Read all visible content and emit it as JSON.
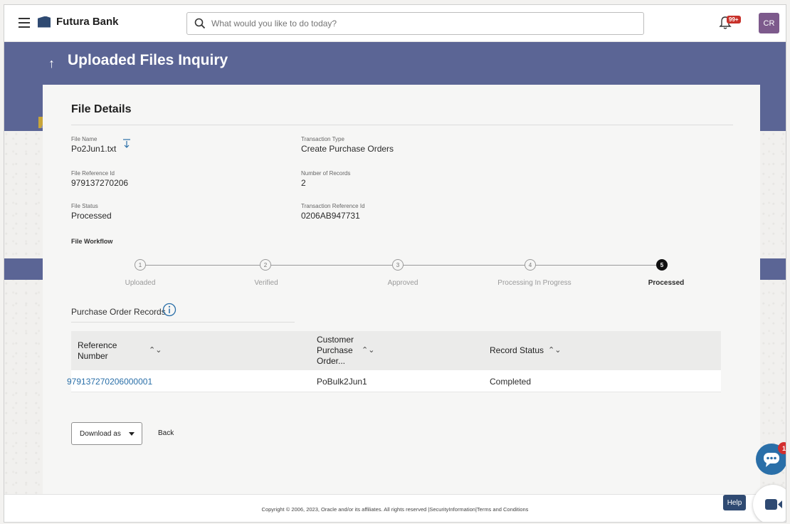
{
  "header": {
    "brand": "Futura Bank",
    "search_placeholder": "What would you like to do today?",
    "notification_badge": "99+",
    "avatar_initials": "CR"
  },
  "page": {
    "title": "Uploaded Files Inquiry"
  },
  "file_details": {
    "section_title": "File Details",
    "fields": {
      "file_name": {
        "label": "File Name",
        "value": "Po2Jun1.txt"
      },
      "transaction_type": {
        "label": "Transaction Type",
        "value": "Create Purchase Orders"
      },
      "file_reference_id": {
        "label": "File Reference Id",
        "value": "979137270206"
      },
      "number_of_records": {
        "label": "Number of Records",
        "value": "2"
      },
      "file_status": {
        "label": "File Status",
        "value": "Processed"
      },
      "transaction_reference_id": {
        "label": "Transaction Reference Id",
        "value": "0206AB947731"
      }
    }
  },
  "workflow": {
    "title": "File Workflow",
    "steps": [
      {
        "number": "1",
        "label": "Uploaded",
        "state": "pending"
      },
      {
        "number": "2",
        "label": "Verified",
        "state": "pending"
      },
      {
        "number": "3",
        "label": "Approved",
        "state": "pending"
      },
      {
        "number": "4",
        "label": "Processing In Progress",
        "state": "pending"
      },
      {
        "number": "5",
        "label": "Processed",
        "state": "done"
      }
    ]
  },
  "records": {
    "title": "Purchase Order Records",
    "columns": [
      {
        "label_line1": "Reference",
        "label_line2": "Number",
        "label_line3": ""
      },
      {
        "label_line1": "Customer",
        "label_line2": "Purchase",
        "label_line3": "Order..."
      },
      {
        "label_line1": "Record Status",
        "label_line2": "",
        "label_line3": ""
      }
    ],
    "rows": [
      {
        "reference_number": "979137270206000001",
        "customer_po": "PoBulk2Jun1",
        "record_status": "Completed"
      }
    ]
  },
  "actions": {
    "download_label": "Download as",
    "back_label": "Back"
  },
  "footer": {
    "text": "Copyright © 2006, 2023, Oracle and/or its affiliates. All rights reserved |SecurityInformation|Terms and Conditions"
  },
  "floating": {
    "chat_badge": "1",
    "help_label": "Help"
  },
  "colors": {
    "banner": "#5b6595",
    "link": "#2a6fa8",
    "brand_dark": "#2f4a72",
    "avatar": "#7d5a8c",
    "alert": "#d32f2f"
  }
}
